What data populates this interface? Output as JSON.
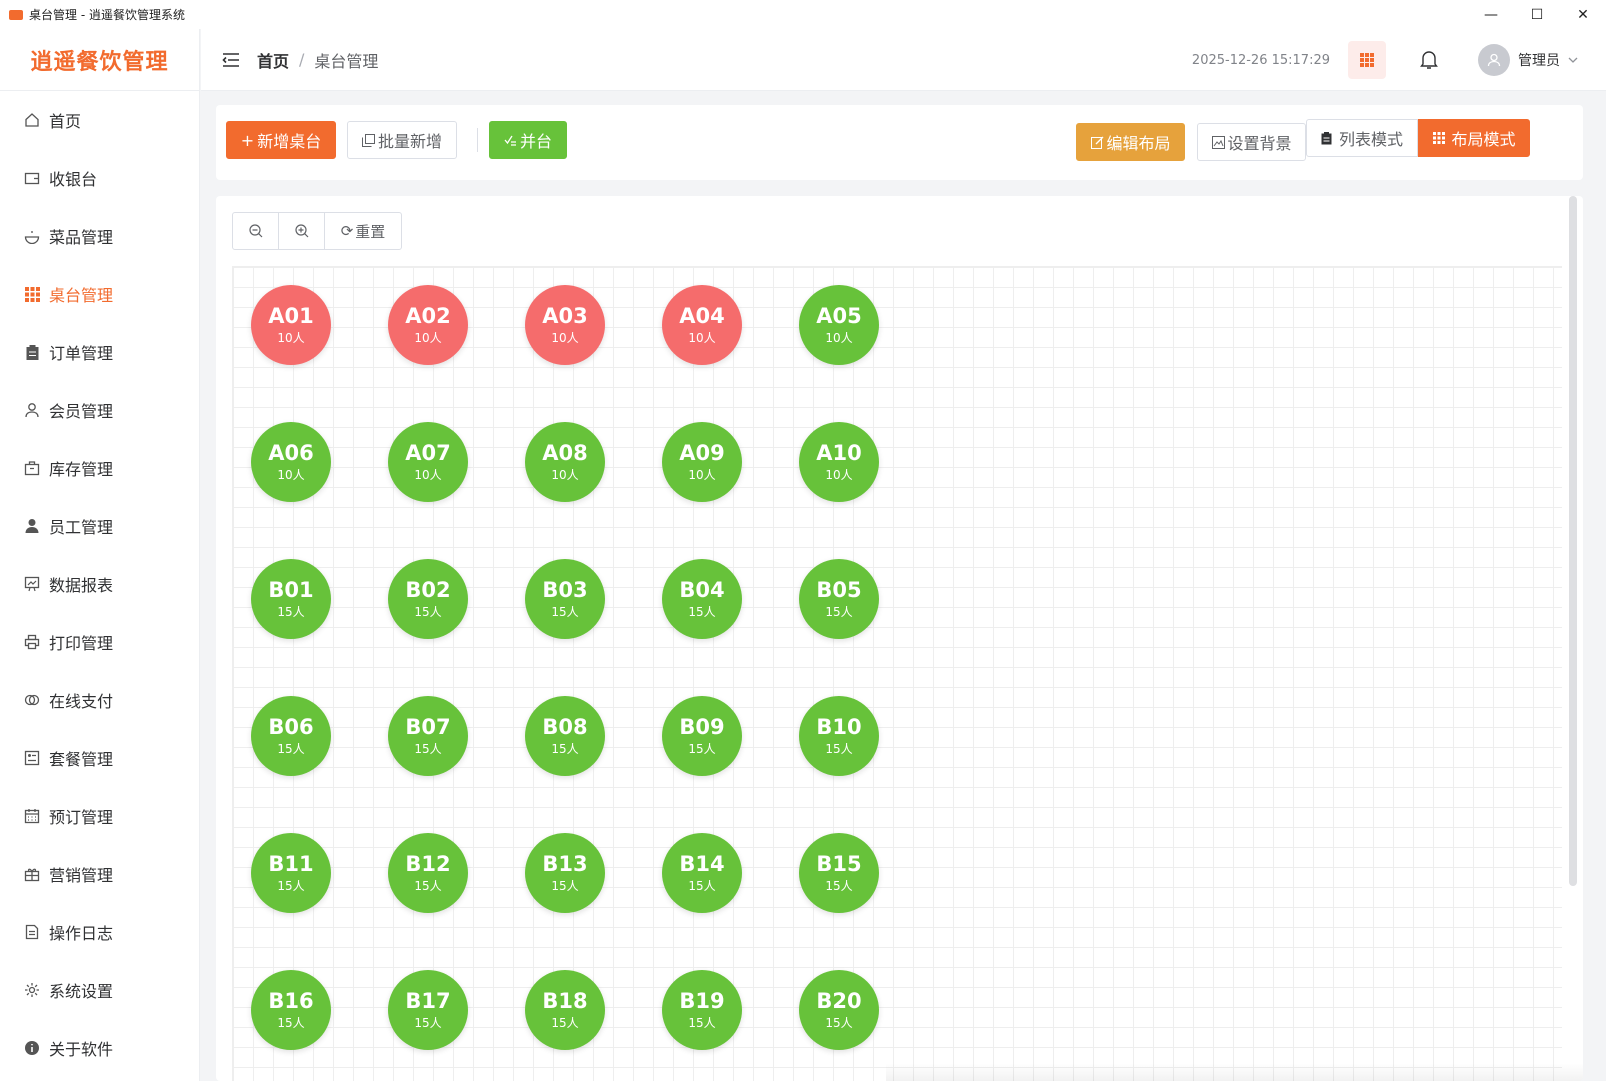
{
  "window": {
    "title": "桌台管理 - 逍遥餐饮管理系统",
    "controls": {
      "minimize": "—",
      "maximize": "☐",
      "close": "✕"
    }
  },
  "sidebar": {
    "brand": "逍遥餐饮管理",
    "items": [
      {
        "label": "首页",
        "icon": "home-icon"
      },
      {
        "label": "收银台",
        "icon": "wallet-icon"
      },
      {
        "label": "菜品管理",
        "icon": "dish-icon"
      },
      {
        "label": "桌台管理",
        "icon": "grid-icon",
        "active": true
      },
      {
        "label": "订单管理",
        "icon": "clipboard-icon"
      },
      {
        "label": "会员管理",
        "icon": "user-icon"
      },
      {
        "label": "库存管理",
        "icon": "box-icon"
      },
      {
        "label": "员工管理",
        "icon": "person-icon"
      },
      {
        "label": "数据报表",
        "icon": "chart-icon"
      },
      {
        "label": "打印管理",
        "icon": "printer-icon"
      },
      {
        "label": "在线支付",
        "icon": "payment-icon"
      },
      {
        "label": "套餐管理",
        "icon": "combo-icon"
      },
      {
        "label": "预订管理",
        "icon": "calendar-icon"
      },
      {
        "label": "营销管理",
        "icon": "gift-icon"
      },
      {
        "label": "操作日志",
        "icon": "document-icon"
      },
      {
        "label": "系统设置",
        "icon": "gear-icon"
      },
      {
        "label": "关于软件",
        "icon": "info-icon"
      }
    ]
  },
  "header": {
    "breadcrumb": {
      "home": "首页",
      "separator": "/",
      "current": "桌台管理"
    },
    "datetime": "2025-12-26 15:17:29",
    "user": "管理员"
  },
  "toolbar": {
    "add_table": "新增桌台",
    "batch_add": "批量新增",
    "merge": "并台",
    "edit_layout": "编辑布局",
    "set_background": "设置背景",
    "list_mode": "列表模式",
    "layout_mode": "布局模式"
  },
  "zoom": {
    "reset": "重置"
  },
  "colors": {
    "accent": "#f26b2e",
    "occupied": "#f56c6c",
    "free": "#67c23a",
    "amber": "#e6a23c"
  },
  "tables": [
    {
      "name": "A01",
      "capacity": "10人",
      "status": "occupied"
    },
    {
      "name": "A02",
      "capacity": "10人",
      "status": "occupied"
    },
    {
      "name": "A03",
      "capacity": "10人",
      "status": "occupied"
    },
    {
      "name": "A04",
      "capacity": "10人",
      "status": "occupied"
    },
    {
      "name": "A05",
      "capacity": "10人",
      "status": "free"
    },
    {
      "name": "A06",
      "capacity": "10人",
      "status": "free"
    },
    {
      "name": "A07",
      "capacity": "10人",
      "status": "free"
    },
    {
      "name": "A08",
      "capacity": "10人",
      "status": "free"
    },
    {
      "name": "A09",
      "capacity": "10人",
      "status": "free"
    },
    {
      "name": "A10",
      "capacity": "10人",
      "status": "free"
    },
    {
      "name": "B01",
      "capacity": "15人",
      "status": "free"
    },
    {
      "name": "B02",
      "capacity": "15人",
      "status": "free"
    },
    {
      "name": "B03",
      "capacity": "15人",
      "status": "free"
    },
    {
      "name": "B04",
      "capacity": "15人",
      "status": "free"
    },
    {
      "name": "B05",
      "capacity": "15人",
      "status": "free"
    },
    {
      "name": "B06",
      "capacity": "15人",
      "status": "free"
    },
    {
      "name": "B07",
      "capacity": "15人",
      "status": "free"
    },
    {
      "name": "B08",
      "capacity": "15人",
      "status": "free"
    },
    {
      "name": "B09",
      "capacity": "15人",
      "status": "free"
    },
    {
      "name": "B10",
      "capacity": "15人",
      "status": "free"
    },
    {
      "name": "B11",
      "capacity": "15人",
      "status": "free"
    },
    {
      "name": "B12",
      "capacity": "15人",
      "status": "free"
    },
    {
      "name": "B13",
      "capacity": "15人",
      "status": "free"
    },
    {
      "name": "B14",
      "capacity": "15人",
      "status": "free"
    },
    {
      "name": "B15",
      "capacity": "15人",
      "status": "free"
    },
    {
      "name": "B16",
      "capacity": "15人",
      "status": "free"
    },
    {
      "name": "B17",
      "capacity": "15人",
      "status": "free"
    },
    {
      "name": "B18",
      "capacity": "15人",
      "status": "free"
    },
    {
      "name": "B19",
      "capacity": "15人",
      "status": "free"
    },
    {
      "name": "B20",
      "capacity": "15人",
      "status": "free"
    }
  ]
}
